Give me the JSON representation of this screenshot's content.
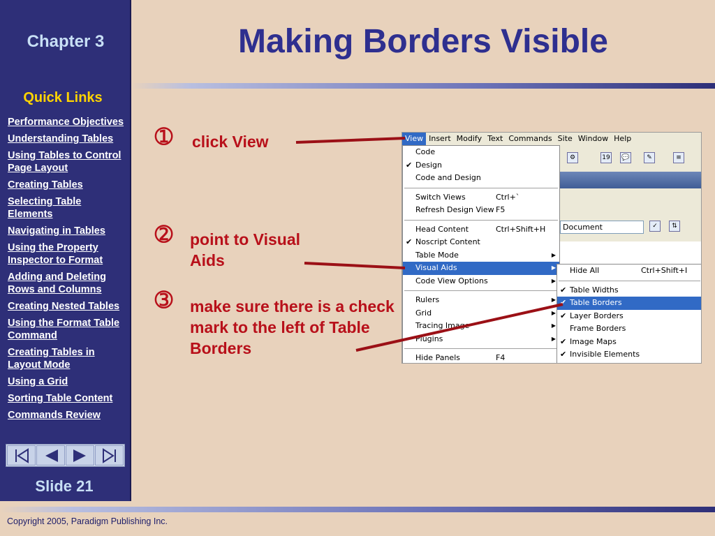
{
  "sidebar": {
    "chapter": "Chapter 3",
    "quick_links_title": "Quick Links",
    "links": [
      "Performance Objectives",
      "Understanding Tables",
      "Using Tables to Control Page Layout",
      "Creating Tables",
      "Selecting Table Elements",
      "Navigating in Tables",
      "Using the Property Inspector to Format",
      "Adding and Deleting Rows and Columns",
      "Creating Nested Tables",
      "Using the Format Table Command",
      "Creating Tables in Layout Mode",
      "Using a Grid",
      "Sorting Table Content",
      "Commands Review"
    ],
    "nav_buttons": [
      "first-slide-icon",
      "previous-slide-icon",
      "next-slide-icon",
      "last-slide-icon"
    ],
    "slide_label": "Slide 21"
  },
  "title": "Making Borders Visible",
  "steps": [
    {
      "num": "➀",
      "text": "click View"
    },
    {
      "num": "➁",
      "text": "point to Visual Aids"
    },
    {
      "num": "➂",
      "text": "make sure there is a check mark to the left of Table Borders"
    }
  ],
  "screenshot": {
    "menubar": [
      "View",
      "Insert",
      "Modify",
      "Text",
      "Commands",
      "Site",
      "Window",
      "Help"
    ],
    "document_field": "Document",
    "view_menu": [
      {
        "label": "Code",
        "check": "",
        "shortcut": "",
        "submenu": false
      },
      {
        "label": "Design",
        "check": "✔",
        "shortcut": "",
        "submenu": false
      },
      {
        "label": "Code and Design",
        "check": "",
        "shortcut": "",
        "submenu": false
      },
      {
        "label": "Switch Views",
        "check": "",
        "shortcut": "Ctrl+`",
        "submenu": false
      },
      {
        "label": "Refresh Design View",
        "check": "",
        "shortcut": "F5",
        "submenu": false
      },
      {
        "label": "Head Content",
        "check": "",
        "shortcut": "Ctrl+Shift+H",
        "submenu": false
      },
      {
        "label": "Noscript Content",
        "check": "✔",
        "shortcut": "",
        "submenu": false
      },
      {
        "label": "Table Mode",
        "check": "",
        "shortcut": "",
        "submenu": true
      },
      {
        "label": "Visual Aids",
        "check": "",
        "shortcut": "",
        "submenu": true
      },
      {
        "label": "Code View Options",
        "check": "",
        "shortcut": "",
        "submenu": true
      },
      {
        "label": "Rulers",
        "check": "",
        "shortcut": "",
        "submenu": true
      },
      {
        "label": "Grid",
        "check": "",
        "shortcut": "",
        "submenu": true
      },
      {
        "label": "Tracing Image",
        "check": "",
        "shortcut": "",
        "submenu": true
      },
      {
        "label": "Plugins",
        "check": "",
        "shortcut": "",
        "submenu": true
      },
      {
        "label": "Hide Panels",
        "check": "",
        "shortcut": "F4",
        "submenu": false
      }
    ],
    "visual_aids_menu": [
      {
        "label": "Hide All",
        "check": "",
        "shortcut": "Ctrl+Shift+I"
      },
      {
        "label": "Table Widths",
        "check": "✔",
        "shortcut": ""
      },
      {
        "label": "Table Borders",
        "check": "✔",
        "shortcut": ""
      },
      {
        "label": "Layer Borders",
        "check": "✔",
        "shortcut": ""
      },
      {
        "label": "Frame Borders",
        "check": "",
        "shortcut": ""
      },
      {
        "label": "Image Maps",
        "check": "✔",
        "shortcut": ""
      },
      {
        "label": "Invisible Elements",
        "check": "✔",
        "shortcut": ""
      }
    ]
  },
  "copyright": "Copyright 2005, Paradigm Publishing Inc.",
  "colors": {
    "sidebar": "#2e2f78",
    "background": "#e8d2bc",
    "title": "#2e2f8f",
    "step_red": "#b8101a",
    "quick_links": "#ffd400",
    "menu_highlight": "#316ac5"
  }
}
